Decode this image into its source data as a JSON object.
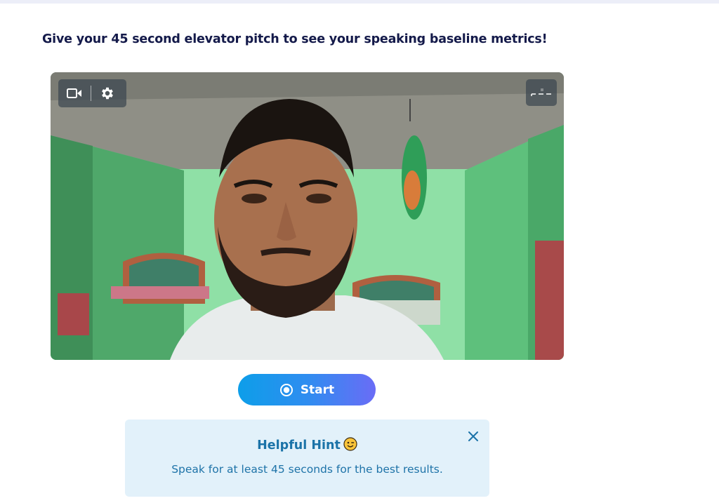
{
  "page": {
    "heading": "Give your 45 second elevator pitch to see your speaking baseline metrics!"
  },
  "video": {
    "controls": [
      {
        "icon": "video-camera-icon",
        "action": "camera"
      },
      {
        "icon": "gear-icon",
        "action": "settings"
      }
    ],
    "fullscreen_icon": "fullscreen-icon"
  },
  "record": {
    "start_label": "Start",
    "icon": "record-circle-icon"
  },
  "hint": {
    "title": "Helpful Hint",
    "emoji": "winking-face-icon",
    "text": "Speak for at least 45 seconds for the best results.",
    "close_icon": "close-icon"
  },
  "colors": {
    "heading": "#141a4a",
    "accent_start": "#0d9ee9",
    "accent_end": "#6a6cf6",
    "hint_bg": "#e2f1fa",
    "hint_text": "#1b73a8"
  }
}
